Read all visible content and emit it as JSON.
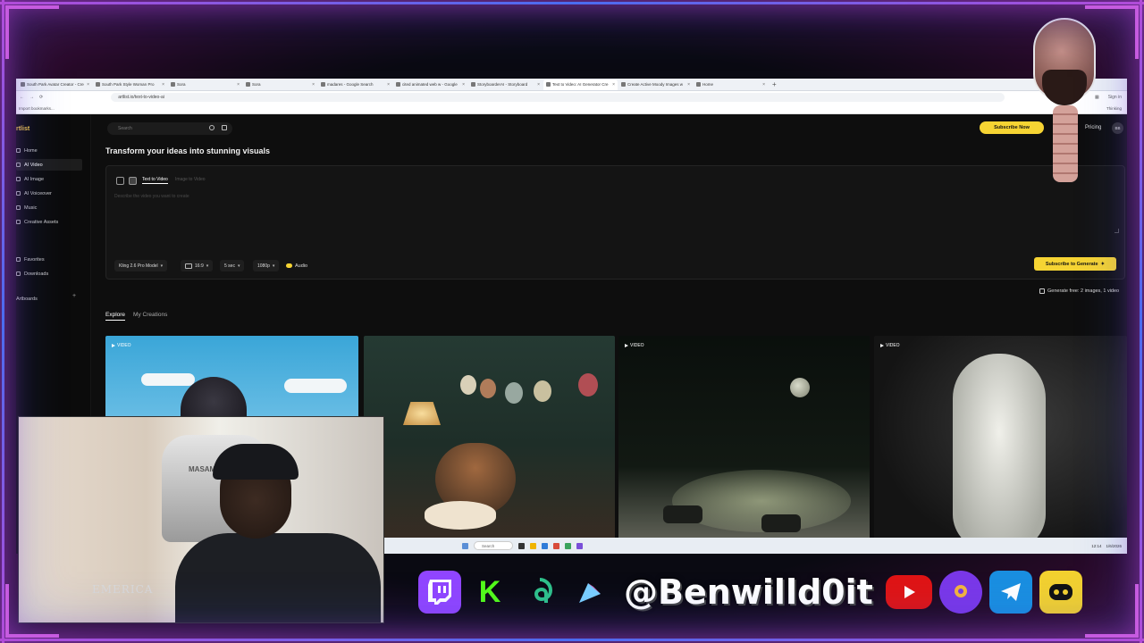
{
  "browser": {
    "tabs": [
      {
        "label": "South Park Avatar Creator - Cre"
      },
      {
        "label": "South Park Style Woman Pro"
      },
      {
        "label": "Sora"
      },
      {
        "label": "Sora"
      },
      {
        "label": "madares - Google Search"
      },
      {
        "label": "cited animated web w - Google"
      },
      {
        "label": "StoryboarderAI - Storyboard"
      },
      {
        "label": "Text to Video: AI Generator Cre"
      },
      {
        "label": "Create Active Moody Images w"
      },
      {
        "label": "Home"
      }
    ],
    "active_tab_index": 7,
    "url": "artlist.io/text-to-video-ai",
    "bookmarks_label": "Import bookmarks...",
    "signin_label": "Sign in",
    "thinking_label": "Thinking"
  },
  "app": {
    "logo": "rtlist",
    "search_placeholder": "Search",
    "subscribe_label": "Subscribe Now",
    "pricing_label": "Pricing",
    "avatar_initials": "BB",
    "nav": [
      {
        "label": "Home",
        "icon": "home-icon"
      },
      {
        "label": "AI Video",
        "icon": "video-icon"
      },
      {
        "label": "AI Image",
        "icon": "image-icon"
      },
      {
        "label": "AI Voiceover",
        "icon": "mic-icon"
      },
      {
        "label": "Music",
        "icon": "music-icon"
      },
      {
        "label": "Creative Assets",
        "icon": "assets-icon"
      }
    ],
    "nav_secondary": [
      {
        "label": "Favorites",
        "icon": "heart-icon"
      },
      {
        "label": "Downloads",
        "icon": "download-icon"
      }
    ],
    "artboards_label": "Artboards",
    "heading": "Transform your ideas into stunning visuals",
    "composer": {
      "mode_text": "Text to Video",
      "mode_image": "Image to Video",
      "prompt_placeholder": "Describe the video you want to create",
      "model": "Kling 2.6 Pro Model",
      "ratio": "16:9",
      "duration": "5 sec",
      "resolution": "1080p",
      "audio_label": "Audio",
      "generate_label": "Subscribe to Generate"
    },
    "free_label": "Generate free: 2 images, 1 video",
    "tabs": {
      "explore": "Explore",
      "creations": "My Creations"
    },
    "cards": [
      {
        "badge": "VIDEO"
      },
      {
        "badge": ""
      },
      {
        "badge": "VIDEO"
      },
      {
        "badge": "VIDEO"
      }
    ]
  },
  "taskbar": {
    "search_label": "Search",
    "time": "12:14",
    "date": "1/6/2026"
  },
  "webcam": {
    "chair_text": "MASAMUNE",
    "shirt_text": "EMERICA"
  },
  "overlay": {
    "handle": "@Benwilld0it",
    "icons": [
      "twitch-icon",
      "kick-icon",
      "thread-icon",
      "bluesky-icon",
      "youtube-icon",
      "patreon-icon",
      "telegram-icon",
      "discord-icon"
    ],
    "colors": {
      "frame": "#c65be0",
      "accent": "#f6d433",
      "twitch": "#9146ff",
      "kick": "#53fc18",
      "youtube": "#ff0000"
    }
  }
}
